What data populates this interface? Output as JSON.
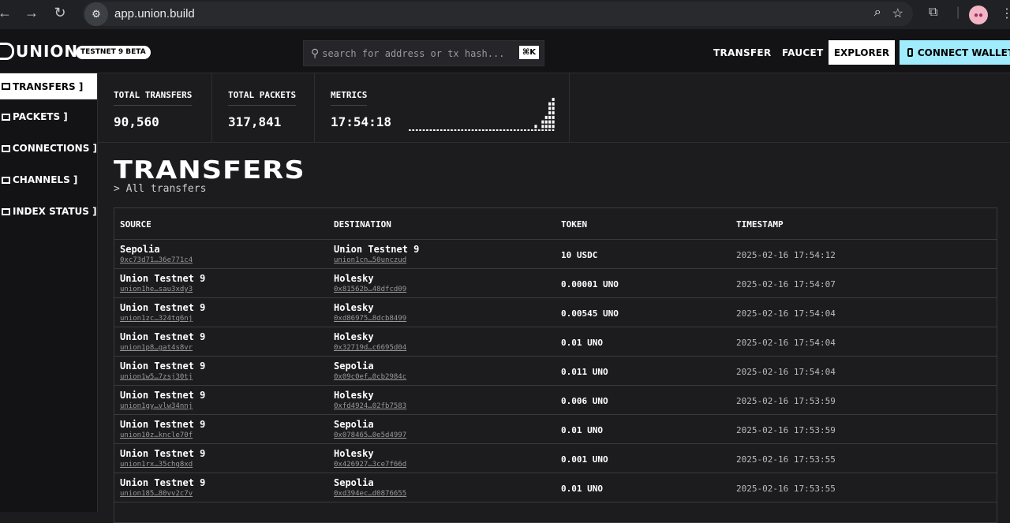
{
  "browser": {
    "url": "app.union.build",
    "back_icon": "arrow-left",
    "forward_icon": "arrow-right",
    "reload_icon": "reload",
    "zoom_icon": "magnifier",
    "star_icon": "star",
    "extensions_icon": "puzzle",
    "menu_icon": "kebab"
  },
  "header": {
    "logo_text": "UNION",
    "badge": "TESTNET 9 BETA",
    "search_placeholder": "search for address or tx hash...",
    "search_shortcut": "⌘K",
    "nav": [
      "TRANSFER",
      "FAUCET"
    ],
    "explorer_label": "EXPLORER",
    "wallet_label": "CONNECT WALLET"
  },
  "sidebar": {
    "items": [
      {
        "label": "TRANSFERS ]",
        "active": true
      },
      {
        "label": "PACKETS ]",
        "active": false
      },
      {
        "label": "CONNECTIONS ]",
        "active": false
      },
      {
        "label": "CHANNELS ]",
        "active": false
      },
      {
        "label": "INDEX STATUS ]",
        "active": false
      }
    ]
  },
  "stats": {
    "total_transfers_label": "TOTAL TRANSFERS",
    "total_transfers_value": "90,560",
    "total_packets_label": "TOTAL PACKETS",
    "total_packets_value": "317,841",
    "metrics_label": "METRICS",
    "metrics_value": "17:54:18"
  },
  "chart_data": {
    "type": "bar",
    "values": [
      0,
      0,
      0,
      0,
      0,
      0,
      0,
      0,
      0,
      0,
      0,
      0,
      0,
      0,
      0,
      0,
      0,
      0,
      0,
      0,
      0,
      0,
      0,
      0,
      0,
      0,
      0,
      0,
      0,
      0,
      0,
      0,
      0,
      0,
      0,
      0,
      1,
      0,
      2,
      3,
      6,
      7
    ],
    "ylim": [
      0,
      7
    ]
  },
  "page": {
    "title": "TRANSFERS",
    "subtitle": "> All transfers"
  },
  "table": {
    "headers": {
      "source": "SOURCE",
      "destination": "DESTINATION",
      "token": "TOKEN",
      "timestamp": "TIMESTAMP"
    },
    "rows": [
      {
        "src": "Sepolia",
        "src_addr": "0xc73d71…36e771c4",
        "dst": "Union Testnet 9",
        "dst_addr": "union1cn…50unczud",
        "token": "10 USDC",
        "ts": "2025-02-16 17:54:12"
      },
      {
        "src": "Union Testnet 9",
        "src_addr": "union1he…sau3xdy3",
        "dst": "Holesky",
        "dst_addr": "0x81562b…48dfcd09",
        "token": "0.00001 UNO",
        "ts": "2025-02-16 17:54:07"
      },
      {
        "src": "Union Testnet 9",
        "src_addr": "union1zc…324tq6nj",
        "dst": "Holesky",
        "dst_addr": "0xd86975…8dcb8499",
        "token": "0.00545 UNO",
        "ts": "2025-02-16 17:54:04"
      },
      {
        "src": "Union Testnet 9",
        "src_addr": "union1p8…gat4s8vr",
        "dst": "Holesky",
        "dst_addr": "0x32719d…c6695d04",
        "token": "0.01 UNO",
        "ts": "2025-02-16 17:54:04"
      },
      {
        "src": "Union Testnet 9",
        "src_addr": "union1w5…7zsj30tj",
        "dst": "Sepolia",
        "dst_addr": "0x09c0ef…0cb2984c",
        "token": "0.011 UNO",
        "ts": "2025-02-16 17:54:04"
      },
      {
        "src": "Union Testnet 9",
        "src_addr": "union1gy…vlw34nnj",
        "dst": "Holesky",
        "dst_addr": "0xfd4924…02fb7583",
        "token": "0.006 UNO",
        "ts": "2025-02-16 17:53:59"
      },
      {
        "src": "Union Testnet 9",
        "src_addr": "union10z…kncle70f",
        "dst": "Sepolia",
        "dst_addr": "0x078465…0e5d4997",
        "token": "0.01 UNO",
        "ts": "2025-02-16 17:53:59"
      },
      {
        "src": "Union Testnet 9",
        "src_addr": "union1rx…35chg8xd",
        "dst": "Holesky",
        "dst_addr": "0x426927…3ce7f66d",
        "token": "0.001 UNO",
        "ts": "2025-02-16 17:53:55"
      },
      {
        "src": "Union Testnet 9",
        "src_addr": "union185…80vv2c7v",
        "dst": "Sepolia",
        "dst_addr": "0xd394ec…d0876655",
        "token": "0.01 UNO",
        "ts": "2025-02-16 17:53:55"
      }
    ]
  }
}
